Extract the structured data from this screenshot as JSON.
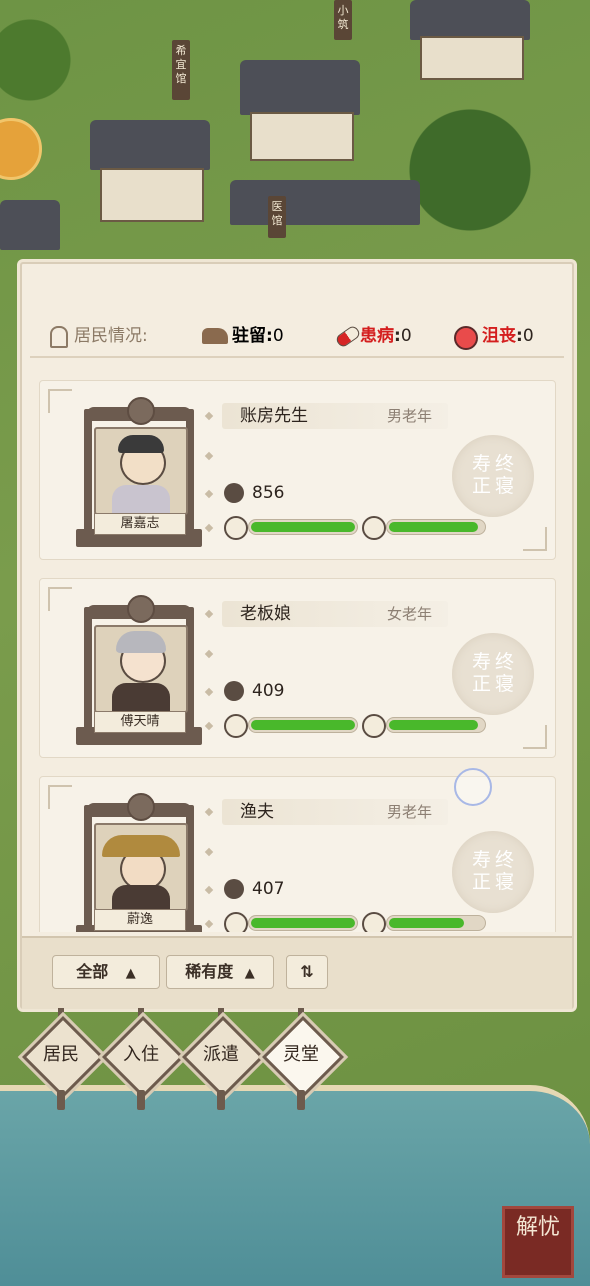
{
  "map": {
    "signs": [
      "希宜馆",
      "小筑",
      "医馆"
    ]
  },
  "header": {
    "title": "居民情况:",
    "stats": [
      {
        "label": "驻留",
        "sep": ":",
        "value": "0",
        "color": "#2d241e",
        "icon": "horse-icon"
      },
      {
        "label": "患病",
        "sep": ":",
        "value": "0",
        "color": "#d41e1e",
        "icon": "pill-icon"
      },
      {
        "label": "沮丧",
        "sep": ":",
        "value": "0",
        "color": "#d41e1e",
        "icon": "sad-face-icon"
      }
    ]
  },
  "residents": [
    {
      "name": "屠嘉志",
      "role": "账房先生",
      "age": "男老年",
      "hp": "856",
      "bar1": 1.0,
      "bar2": 0.95,
      "seal": [
        "寿",
        "终",
        "正",
        "寝"
      ]
    },
    {
      "name": "傅天晴",
      "role": "老板娘",
      "age": "女老年",
      "hp": "409",
      "bar1": 1.0,
      "bar2": 0.95,
      "seal": [
        "寿",
        "终",
        "正",
        "寝"
      ]
    },
    {
      "name": "蔚逸",
      "role": "渔夫",
      "age": "男老年",
      "hp": "407",
      "bar1": 1.0,
      "bar2": 0.8,
      "seal": [
        "寿",
        "终",
        "正",
        "寝"
      ]
    }
  ],
  "toolbar": {
    "filter_all": "全部",
    "filter_rarity": "稀有度",
    "sort_icon": "sort-icon"
  },
  "tabs": [
    {
      "label": "居民",
      "active": false
    },
    {
      "label": "入住",
      "active": false
    },
    {
      "label": "派遣",
      "active": false
    },
    {
      "label": "灵堂",
      "active": true
    }
  ],
  "logo": {
    "text": "解忧"
  },
  "colors": {
    "accent_green": "#49b82b",
    "alert_red": "#d41e1e"
  }
}
